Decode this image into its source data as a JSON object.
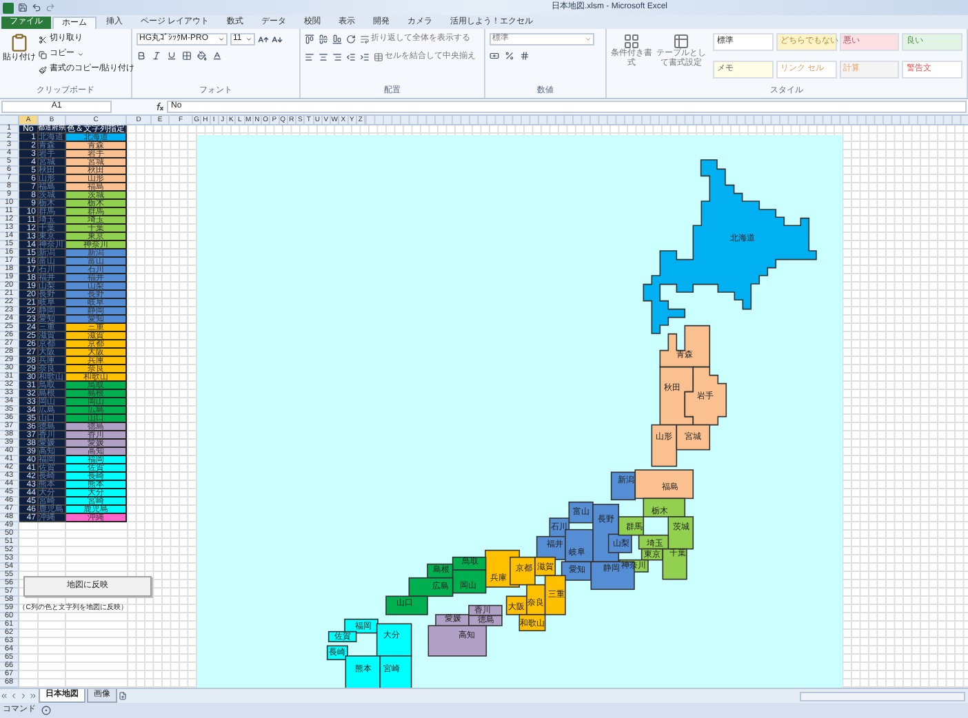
{
  "window": {
    "title": "日本地図.xlsm - Microsoft Excel"
  },
  "ribbon_tabs": [
    {
      "label": "ファイル",
      "kind": "file",
      "selected": false
    },
    {
      "label": "ホーム",
      "kind": "tab",
      "selected": true
    },
    {
      "label": "挿入",
      "kind": "tab",
      "selected": false
    },
    {
      "label": "ページ レイアウト",
      "kind": "tab",
      "selected": false
    },
    {
      "label": "数式",
      "kind": "tab",
      "selected": false
    },
    {
      "label": "データ",
      "kind": "tab",
      "selected": false
    },
    {
      "label": "校閲",
      "kind": "tab",
      "selected": false
    },
    {
      "label": "表示",
      "kind": "tab",
      "selected": false
    },
    {
      "label": "開発",
      "kind": "tab",
      "selected": false
    },
    {
      "label": "カメラ",
      "kind": "tab",
      "selected": false
    },
    {
      "label": "活用しよう！エクセル",
      "kind": "tab",
      "selected": false
    }
  ],
  "clipboard": {
    "paste": "貼り付け",
    "cut": "切り取り",
    "copy": "コピー",
    "format_painter": "書式のコピー/貼り付け",
    "group": "クリップボード"
  },
  "font": {
    "name": "HG丸ｺﾞｼｯｸM-PRO",
    "size": "11",
    "group": "フォント"
  },
  "alignment": {
    "wrap": "折り返して全体を表示する",
    "merge": "セルを結合して中央揃え",
    "group": "配置"
  },
  "number": {
    "format": "標準",
    "group": "数値"
  },
  "styles": {
    "conditional": "条件付き書式",
    "table": "テーブルとして書式設定",
    "group": "スタイル",
    "cells": [
      {
        "label": "標準"
      },
      {
        "label": "どちらでもない"
      },
      {
        "label": "悪い"
      },
      {
        "label": "良い"
      },
      {
        "label": "メモ"
      },
      {
        "label": "リンク セル"
      },
      {
        "label": "計算"
      },
      {
        "label": "警告文"
      }
    ]
  },
  "formula_bar": {
    "name_box": "A1",
    "value": "No"
  },
  "row_headers": [
    "1",
    "2",
    "3",
    "4",
    "5",
    "6",
    "7",
    "8",
    "9",
    "10",
    "11",
    "12",
    "13",
    "14",
    "15",
    "16",
    "17",
    "18",
    "19",
    "20",
    "21",
    "22",
    "23",
    "24",
    "25",
    "26",
    "27",
    "28",
    "29",
    "30",
    "31",
    "32",
    "33",
    "34",
    "35",
    "36",
    "37",
    "38",
    "39",
    "40",
    "41",
    "42",
    "43",
    "44",
    "45",
    "46",
    "47",
    "48",
    "49",
    "50",
    "51",
    "52",
    "53",
    "54",
    "55",
    "56",
    "57",
    "58",
    "59",
    "60",
    "61",
    "62",
    "63",
    "64",
    "65",
    "66",
    "67",
    "68"
  ],
  "columns": [
    "A",
    "B",
    "C",
    "D",
    "E",
    "F",
    "G",
    "H",
    "I",
    "J",
    "K",
    "L",
    "M",
    "N",
    "O",
    "P",
    "Q",
    "R",
    "S",
    "T",
    "U",
    "V",
    "W",
    "X",
    "Y",
    "Z"
  ],
  "table": {
    "columns": [
      "No",
      "都道府県",
      "色＆文字列指定"
    ],
    "rows": [
      {
        "no": "1",
        "name": "北海道",
        "label": "北海道",
        "color": "#00b0f0"
      },
      {
        "no": "2",
        "name": "青森",
        "label": "青森",
        "color": "#fac090"
      },
      {
        "no": "3",
        "name": "岩手",
        "label": "岩手",
        "color": "#fac090"
      },
      {
        "no": "4",
        "name": "宮城",
        "label": "宮城",
        "color": "#fac090"
      },
      {
        "no": "5",
        "name": "秋田",
        "label": "秋田",
        "color": "#fac090"
      },
      {
        "no": "6",
        "name": "山形",
        "label": "山形",
        "color": "#fac090"
      },
      {
        "no": "7",
        "name": "福島",
        "label": "福島",
        "color": "#fac090"
      },
      {
        "no": "8",
        "name": "茨城",
        "label": "茨城",
        "color": "#92d050"
      },
      {
        "no": "9",
        "name": "栃木",
        "label": "栃木",
        "color": "#92d050"
      },
      {
        "no": "10",
        "name": "群馬",
        "label": "群馬",
        "color": "#92d050"
      },
      {
        "no": "11",
        "name": "埼玉",
        "label": "埼玉",
        "color": "#92d050"
      },
      {
        "no": "12",
        "name": "千葉",
        "label": "千葉",
        "color": "#92d050"
      },
      {
        "no": "13",
        "name": "東京",
        "label": "東京",
        "color": "#92d050"
      },
      {
        "no": "14",
        "name": "神奈川",
        "label": "神奈川",
        "color": "#92d050"
      },
      {
        "no": "15",
        "name": "新潟",
        "label": "新潟",
        "color": "#558ed5"
      },
      {
        "no": "16",
        "name": "富山",
        "label": "富山",
        "color": "#558ed5"
      },
      {
        "no": "17",
        "name": "石川",
        "label": "石川",
        "color": "#558ed5"
      },
      {
        "no": "18",
        "name": "福井",
        "label": "福井",
        "color": "#558ed5"
      },
      {
        "no": "19",
        "name": "山梨",
        "label": "山梨",
        "color": "#558ed5"
      },
      {
        "no": "20",
        "name": "長野",
        "label": "長野",
        "color": "#558ed5"
      },
      {
        "no": "21",
        "name": "岐阜",
        "label": "岐阜",
        "color": "#558ed5"
      },
      {
        "no": "22",
        "name": "静岡",
        "label": "静岡",
        "color": "#558ed5"
      },
      {
        "no": "23",
        "name": "愛知",
        "label": "愛知",
        "color": "#558ed5"
      },
      {
        "no": "24",
        "name": "三重",
        "label": "三重",
        "color": "#ffc000"
      },
      {
        "no": "25",
        "name": "滋賀",
        "label": "滋賀",
        "color": "#ffc000"
      },
      {
        "no": "26",
        "name": "京都",
        "label": "京都",
        "color": "#ffc000"
      },
      {
        "no": "27",
        "name": "大阪",
        "label": "大阪",
        "color": "#ffc000"
      },
      {
        "no": "28",
        "name": "兵庫",
        "label": "兵庫",
        "color": "#ffc000"
      },
      {
        "no": "29",
        "name": "奈良",
        "label": "奈良",
        "color": "#ffc000"
      },
      {
        "no": "30",
        "name": "和歌山",
        "label": "和歌山",
        "color": "#ffc000"
      },
      {
        "no": "31",
        "name": "鳥取",
        "label": "鳥取",
        "color": "#00b050"
      },
      {
        "no": "32",
        "name": "島根",
        "label": "島根",
        "color": "#00b050"
      },
      {
        "no": "33",
        "name": "岡山",
        "label": "岡山",
        "color": "#00b050"
      },
      {
        "no": "34",
        "name": "広島",
        "label": "広島",
        "color": "#00b050"
      },
      {
        "no": "35",
        "name": "山口",
        "label": "山口",
        "color": "#00b050"
      },
      {
        "no": "36",
        "name": "徳島",
        "label": "徳島",
        "color": "#b2a1c7"
      },
      {
        "no": "37",
        "name": "香川",
        "label": "香川",
        "color": "#b2a1c7"
      },
      {
        "no": "38",
        "name": "愛媛",
        "label": "愛媛",
        "color": "#b2a1c7"
      },
      {
        "no": "39",
        "name": "高知",
        "label": "高知",
        "color": "#b2a1c7"
      },
      {
        "no": "40",
        "name": "福岡",
        "label": "福岡",
        "color": "#00ffff"
      },
      {
        "no": "41",
        "name": "佐賀",
        "label": "佐賀",
        "color": "#00ffff"
      },
      {
        "no": "42",
        "name": "長崎",
        "label": "長崎",
        "color": "#00ffff"
      },
      {
        "no": "43",
        "name": "熊本",
        "label": "熊本",
        "color": "#00ffff"
      },
      {
        "no": "44",
        "name": "大分",
        "label": "大分",
        "color": "#00ffff"
      },
      {
        "no": "45",
        "name": "宮崎",
        "label": "宮崎",
        "color": "#00ffff"
      },
      {
        "no": "46",
        "name": "鹿児島",
        "label": "鹿児島",
        "color": "#00ffff"
      },
      {
        "no": "47",
        "name": "沖縄",
        "label": "沖縄",
        "color": "#ff66cc"
      }
    ]
  },
  "macro_button": "地図に反映",
  "note": "（C列の色と文字列を地図に反映）",
  "map": {
    "prefectures": [
      {
        "name": "北海道",
        "color": "#00b0f0"
      },
      {
        "name": "青森",
        "color": "#fac090"
      },
      {
        "name": "秋田",
        "color": "#fac090"
      },
      {
        "name": "岩手",
        "color": "#fac090"
      },
      {
        "name": "山形",
        "color": "#fac090"
      },
      {
        "name": "宮城",
        "color": "#fac090"
      },
      {
        "name": "新潟",
        "color": "#558ed5"
      },
      {
        "name": "福島",
        "color": "#fac090"
      },
      {
        "name": "富山",
        "color": "#558ed5"
      },
      {
        "name": "石川",
        "color": "#558ed5"
      },
      {
        "name": "長野",
        "color": "#558ed5"
      },
      {
        "name": "福井",
        "color": "#558ed5"
      },
      {
        "name": "岐阜",
        "color": "#558ed5"
      },
      {
        "name": "山梨",
        "color": "#558ed5"
      },
      {
        "name": "栃木",
        "color": "#92d050"
      },
      {
        "name": "群馬",
        "color": "#92d050"
      },
      {
        "name": "茨城",
        "color": "#92d050"
      },
      {
        "name": "埼玉",
        "color": "#92d050"
      },
      {
        "name": "東京",
        "color": "#92d050"
      },
      {
        "name": "千葉",
        "color": "#92d050"
      },
      {
        "name": "神奈川",
        "color": "#92d050"
      },
      {
        "name": "愛知",
        "color": "#558ed5"
      },
      {
        "name": "静岡",
        "color": "#558ed5"
      },
      {
        "name": "兵庫",
        "color": "#ffc000"
      },
      {
        "name": "京都",
        "color": "#ffc000"
      },
      {
        "name": "滋賀",
        "color": "#ffc000"
      },
      {
        "name": "大阪",
        "color": "#ffc000"
      },
      {
        "name": "奈良",
        "color": "#ffc000"
      },
      {
        "name": "三重",
        "color": "#ffc000"
      },
      {
        "name": "和歌山",
        "color": "#ffc000"
      },
      {
        "name": "鳥取",
        "color": "#00b050"
      },
      {
        "name": "島根",
        "color": "#00b050"
      },
      {
        "name": "岡山",
        "color": "#00b050"
      },
      {
        "name": "広島",
        "color": "#00b050"
      },
      {
        "name": "山口",
        "color": "#00b050"
      },
      {
        "name": "香川",
        "color": "#b2a1c7"
      },
      {
        "name": "愛媛",
        "color": "#b2a1c7"
      },
      {
        "name": "徳島",
        "color": "#b2a1c7"
      },
      {
        "name": "高知",
        "color": "#b2a1c7"
      },
      {
        "name": "福岡",
        "color": "#00ffff"
      },
      {
        "name": "佐賀",
        "color": "#00ffff"
      },
      {
        "name": "長崎",
        "color": "#00ffff"
      },
      {
        "name": "大分",
        "color": "#00ffff"
      },
      {
        "name": "熊本",
        "color": "#00ffff"
      },
      {
        "name": "宮崎",
        "color": "#00ffff"
      }
    ]
  },
  "sheet_tabs": [
    {
      "label": "日本地図",
      "selected": true
    },
    {
      "label": "画像",
      "selected": false
    }
  ],
  "status_bar": {
    "mode": "コマンド"
  }
}
